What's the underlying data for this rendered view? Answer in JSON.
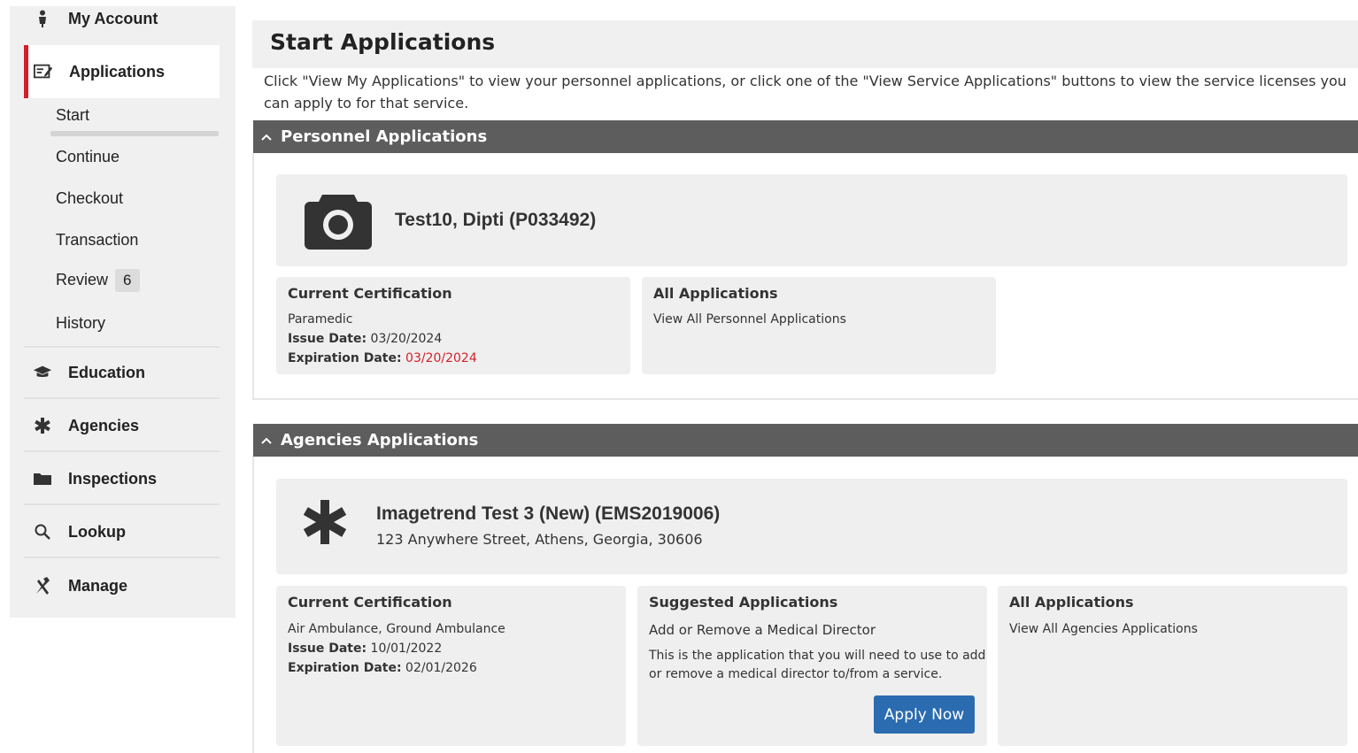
{
  "sidebar": {
    "my_account": "My Account",
    "applications": "Applications",
    "sub_items": {
      "start": "Start",
      "continue": "Continue",
      "checkout": "Checkout",
      "transaction": "Transaction",
      "review": "Review",
      "review_count": "6",
      "history": "History"
    },
    "education": "Education",
    "agencies": "Agencies",
    "inspections": "Inspections",
    "lookup": "Lookup",
    "manage": "Manage",
    "accent_color": "#d31f2a"
  },
  "main": {
    "title": "Start Applications",
    "intro": "Click \"View My Applications\" to view your personnel applications, or click one of the \"View Service Applications\" buttons to view the service licenses you can apply to for that service.",
    "personnel": {
      "section_title": "Personnel Applications",
      "name": "Test10, Dipti (P033492)",
      "current_cert": {
        "heading": "Current Certification",
        "type": "Paramedic",
        "issue_label": "Issue Date:",
        "issue_date": "03/20/2024",
        "exp_label": "Expiration Date:",
        "exp_date": "03/20/2024"
      },
      "all_apps": {
        "heading": "All Applications",
        "link": "View All Personnel Applications"
      }
    },
    "agencies": {
      "section_title": "Agencies Applications",
      "name": "Imagetrend Test 3 (New) (EMS2019006)",
      "address": "123 Anywhere Street, Athens, Georgia, 30606",
      "current_cert": {
        "heading": "Current Certification",
        "type": "Air Ambulance, Ground Ambulance",
        "issue_label": "Issue Date:",
        "issue_date": "10/01/2022",
        "exp_label": "Expiration Date:",
        "exp_date": "02/01/2026"
      },
      "suggested": {
        "heading": "Suggested Applications",
        "app_name": "Add or Remove a Medical Director",
        "desc_line1": "This is the application that you will need to use to add",
        "desc_line2": "or remove a medical director to/from a service.",
        "button": "Apply Now"
      },
      "all_apps": {
        "heading": "All Applications",
        "link": "View All Agencies Applications"
      }
    },
    "header_color": "#5d5d5d",
    "button_color": "#2b6cb0",
    "link_color": "#3b6ea5"
  }
}
